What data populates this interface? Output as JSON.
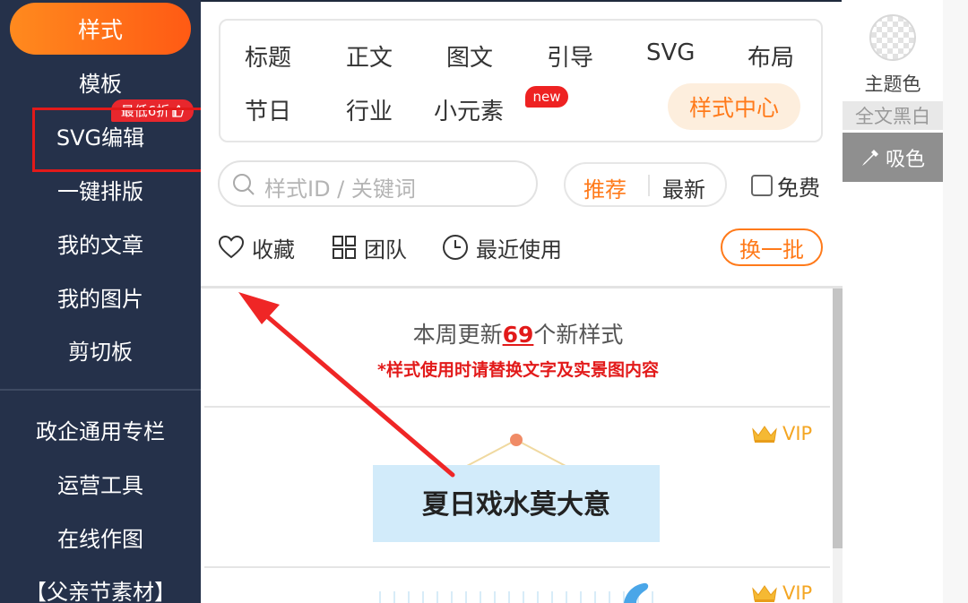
{
  "sidebar": {
    "active": "样式",
    "items": [
      "模板",
      "SVG编辑",
      "一键排版",
      "我的文章",
      "我的图片",
      "剪切板"
    ],
    "items2": [
      "政企通用专栏",
      "运营工具",
      "在线作图",
      "【父亲节素材】"
    ],
    "discount_badge": "最低6折"
  },
  "categories": {
    "row1": [
      "标题",
      "正文",
      "图文",
      "引导",
      "SVG",
      "布局"
    ],
    "row2": [
      "节日",
      "行业",
      "小元素"
    ],
    "new_badge": "new",
    "style_center": "样式中心"
  },
  "search": {
    "placeholder": "样式ID / 关键词"
  },
  "filter": {
    "recommend": "推荐",
    "latest": "最新",
    "free": "免费"
  },
  "quick": {
    "favorites": "收藏",
    "team": "团队",
    "recent": "最近使用",
    "refresh": "换一批"
  },
  "update": {
    "prefix": "本周更新",
    "count": "69",
    "suffix": "个新样式",
    "note": "*样式使用时请替换文字及实景图内容"
  },
  "cards": {
    "vip_label": "VIP",
    "card1_text": "夏日戏水莫大意"
  },
  "right_panel": {
    "theme_color": "主题色",
    "black_white": "全文黑白",
    "color_picker": "吸色"
  },
  "colors": {
    "sidebar_bg": "#25314a",
    "accent": "#ff7a1a",
    "highlight_red": "#e21a1a"
  }
}
